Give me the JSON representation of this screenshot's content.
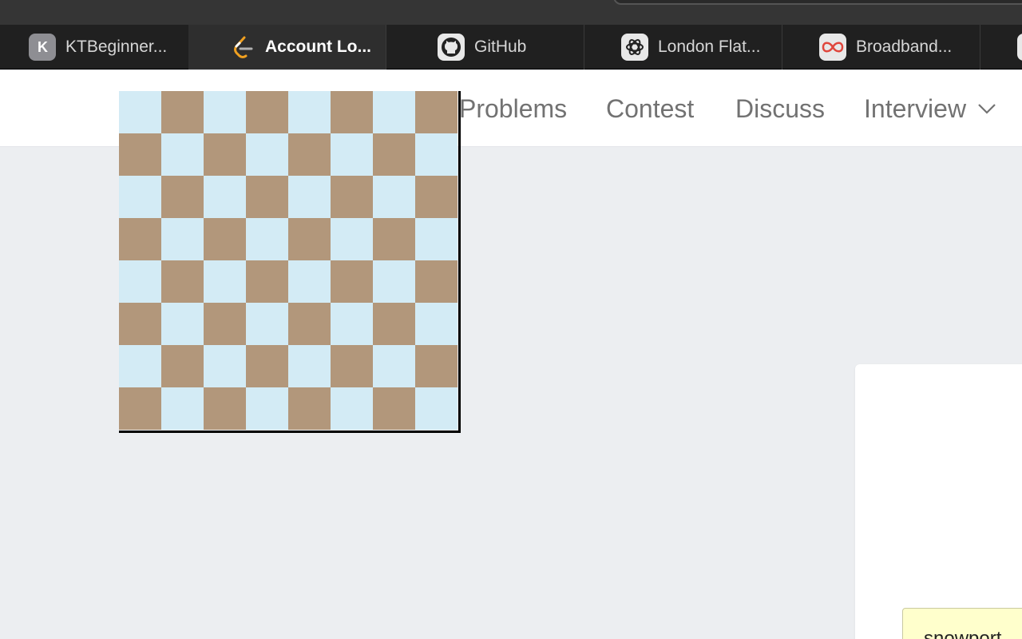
{
  "browser": {
    "tabs": [
      {
        "label": "KTBeginner...",
        "icon": "k-letter-icon",
        "active": false
      },
      {
        "label": "Account Lo...",
        "icon": "leetcode-icon",
        "active": true
      },
      {
        "label": "GitHub",
        "icon": "github-icon",
        "active": false
      },
      {
        "label": "London Flat...",
        "icon": "openai-icon",
        "active": false
      },
      {
        "label": "Broadband...",
        "icon": "infinity-icon",
        "active": false
      }
    ]
  },
  "nav": {
    "problems": "Problems",
    "contest": "Contest",
    "discuss": "Discuss",
    "interview": "Interview"
  },
  "board": {
    "rows": 8,
    "cols": 8,
    "light_color": "#d3ebf5",
    "dark_color": "#b2977b"
  },
  "note": {
    "text": "snowport"
  }
}
